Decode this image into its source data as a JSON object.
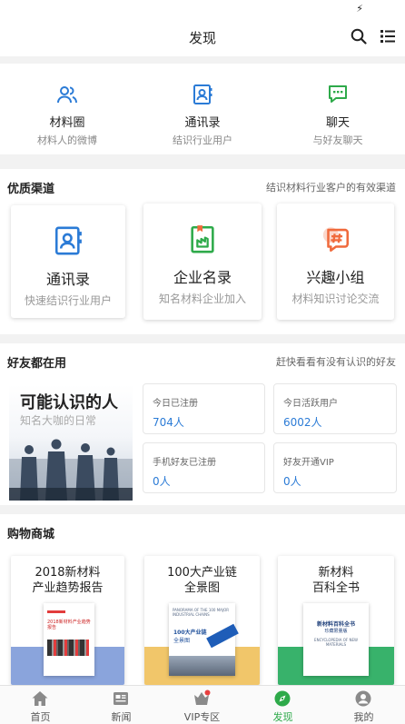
{
  "header": {
    "title": "发现"
  },
  "quick_links": [
    {
      "title": "材料圈",
      "subtitle": "材料人的微博"
    },
    {
      "title": "通讯录",
      "subtitle": "结识行业用户"
    },
    {
      "title": "聊天",
      "subtitle": "与好友聊天"
    }
  ],
  "channels": {
    "title": "优质渠道",
    "subtitle": "结识材料行业客户的有效渠道",
    "items": [
      {
        "title": "通讯录",
        "subtitle": "快速结识行业用户"
      },
      {
        "title": "企业名录",
        "subtitle": "知名材料企业加入"
      },
      {
        "title": "兴趣小组",
        "subtitle": "材料知识讨论交流"
      }
    ]
  },
  "friends": {
    "title": "好友都在用",
    "subtitle": "赶快看看有没有认识的好友",
    "promo_title": "可能认识的人",
    "promo_subtitle": "知名大咖的日常",
    "stats": [
      {
        "label": "今日已注册",
        "value": "704人"
      },
      {
        "label": "今日活跃用户",
        "value": "6002人"
      },
      {
        "label": "手机好友已注册",
        "value": "0人"
      },
      {
        "label": "好友开通VIP",
        "value": "0人"
      }
    ]
  },
  "shop": {
    "title": "购物商城",
    "items": [
      {
        "title_line1": "2018新材料",
        "title_line2": "产业趋势报告",
        "band_color": "#8aa4dc",
        "cover_text": "2018新材料产业趋势报告"
      },
      {
        "title_line1": "100大产业链",
        "title_line2": "全景图",
        "band_color": "#f1c66a",
        "cover_text": "100大产业链",
        "cover_text2": "全景图",
        "cover_en": "PANORAMA OF THE 100 MAJOR INDUSTRIAL CHAINS"
      },
      {
        "title_line1": "新材料",
        "title_line2": "百科全书",
        "band_color": "#38b26b",
        "cover_text": "新材料百科全书",
        "cover_text2": "珍藏限量版",
        "cover_en": "ENCYCLOPEDIA OF NEW MATERIALS"
      }
    ]
  },
  "tabbar": [
    {
      "label": "首页",
      "icon": "home-icon"
    },
    {
      "label": "新闻",
      "icon": "news-icon"
    },
    {
      "label": "VIP专区",
      "icon": "vip-icon"
    },
    {
      "label": "发现",
      "icon": "discover-icon"
    },
    {
      "label": "我的",
      "icon": "profile-icon"
    }
  ],
  "colors": {
    "accent_blue": "#2b7bd6",
    "accent_green": "#2eaa4a",
    "accent_orange": "#f06a3c"
  }
}
